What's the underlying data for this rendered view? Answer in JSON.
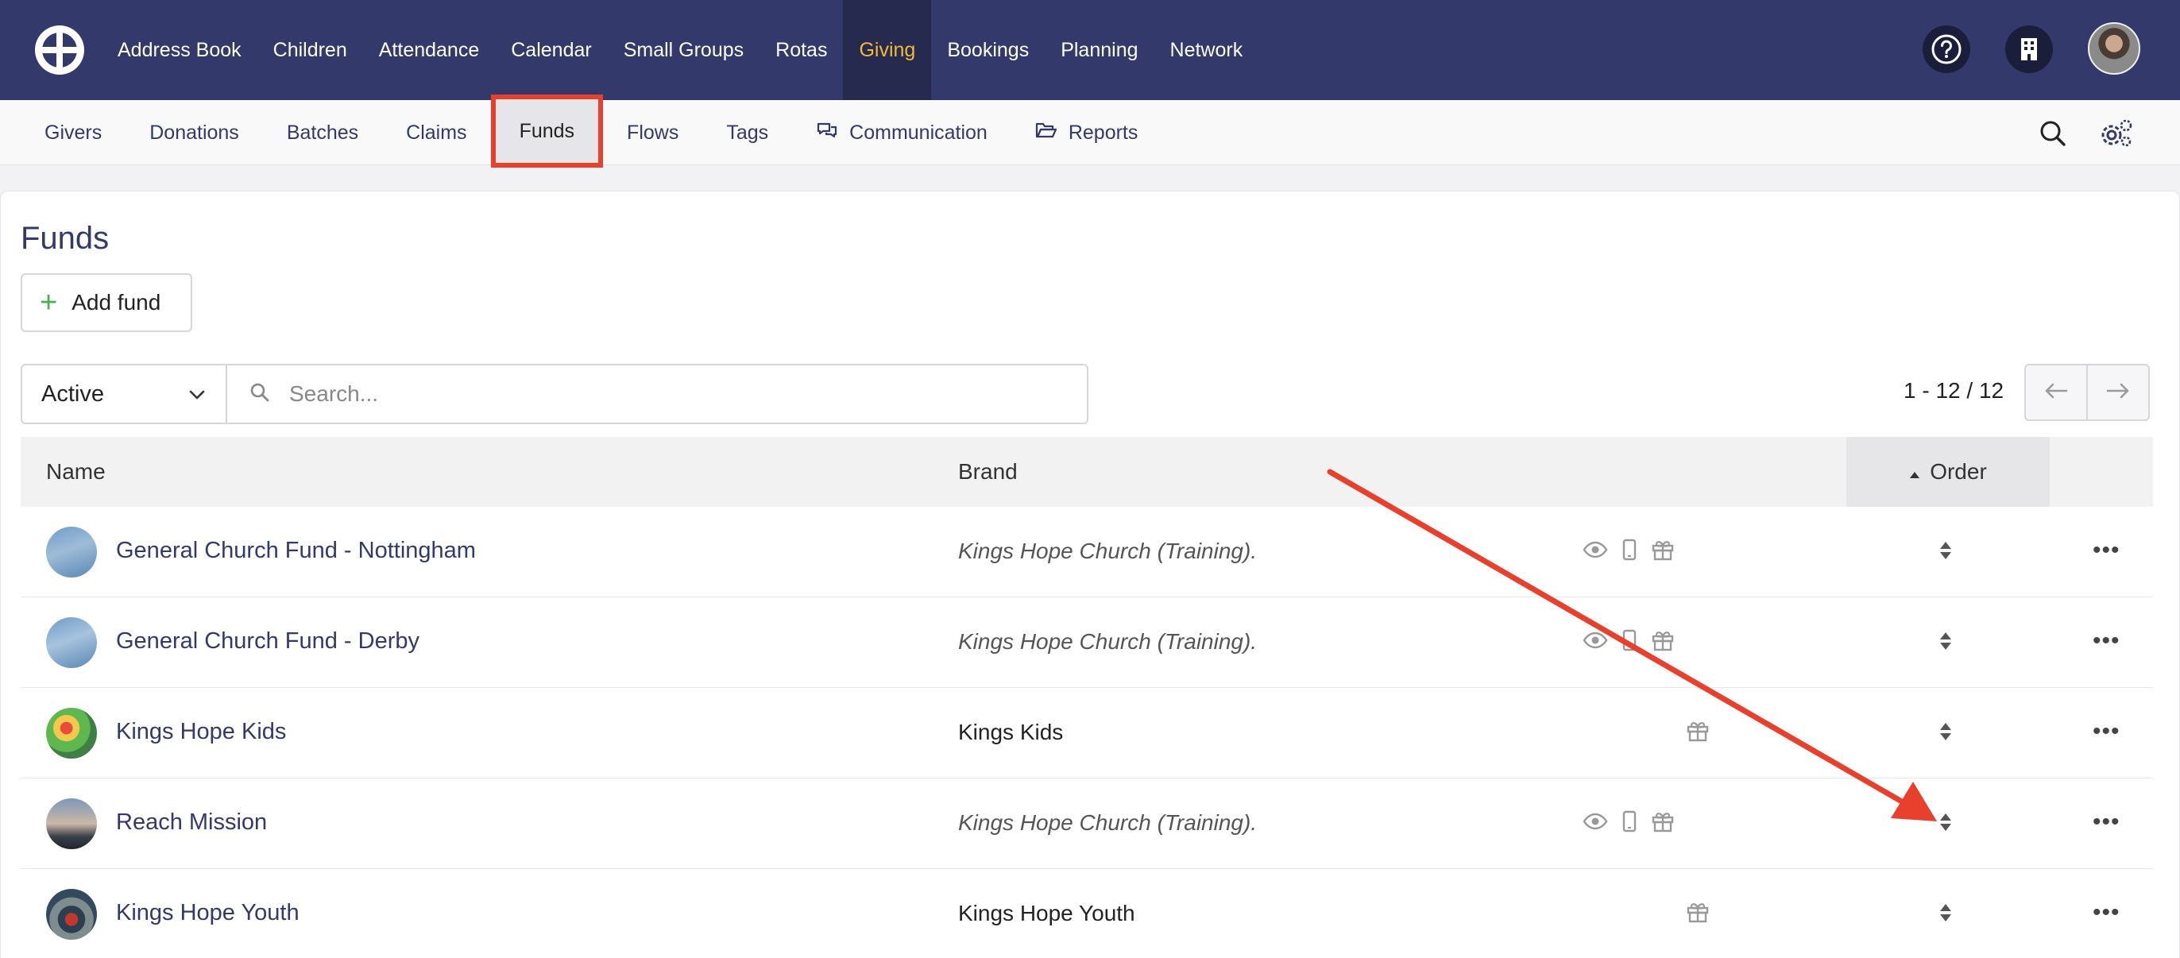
{
  "topnav": {
    "items": [
      "Address Book",
      "Children",
      "Attendance",
      "Calendar",
      "Small Groups",
      "Rotas",
      "Giving",
      "Bookings",
      "Planning",
      "Network"
    ],
    "active": "Giving",
    "active_color": "#f3b93c",
    "bg_color": "#33396a"
  },
  "subnav": {
    "items": [
      "Givers",
      "Donations",
      "Batches",
      "Claims",
      "Funds",
      "Flows",
      "Tags",
      "Communication",
      "Reports"
    ],
    "active": "Funds",
    "highlight_color": "#e8402d"
  },
  "page": {
    "title": "Funds",
    "add_label": "Add fund",
    "filter_value": "Active",
    "search_placeholder": "Search...",
    "pager_text": "1 - 12 / 12"
  },
  "table": {
    "headers": {
      "name": "Name",
      "brand": "Brand",
      "order": "Order"
    },
    "rows": [
      {
        "name": "General Church Fund - Nottingham",
        "brand": "Kings Hope Church (Training).",
        "brand_italic": true,
        "icons": [
          "eye-icon",
          "mobile-icon",
          "gift-icon"
        ]
      },
      {
        "name": "General Church Fund - Derby",
        "brand": "Kings Hope Church (Training).",
        "brand_italic": true,
        "icons": [
          "eye-icon",
          "mobile-icon",
          "gift-icon"
        ]
      },
      {
        "name": "Kings Hope Kids",
        "brand": "Kings Kids",
        "brand_italic": false,
        "icons": [
          "gift-icon"
        ]
      },
      {
        "name": "Reach Mission",
        "brand": "Kings Hope Church (Training).",
        "brand_italic": true,
        "icons": [
          "eye-icon",
          "mobile-icon",
          "gift-icon"
        ]
      },
      {
        "name": "Kings Hope Youth",
        "brand": "Kings Hope Youth",
        "brand_italic": false,
        "icons": [
          "gift-icon"
        ]
      }
    ]
  },
  "annotation": {
    "arrow_color": "#e8402d"
  }
}
